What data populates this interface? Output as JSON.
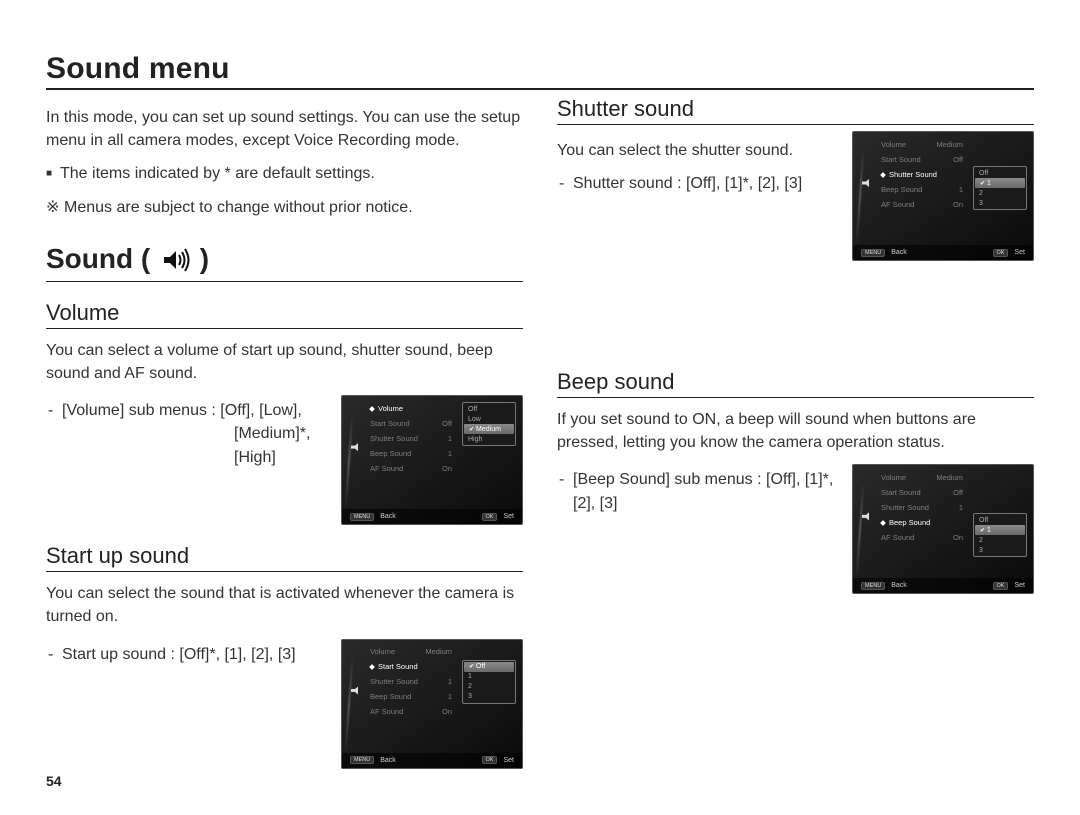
{
  "page_number": "54",
  "page_title": "Sound menu",
  "intro_text": "In this mode, you can set up sound settings. You can use the setup menu in all camera modes, except Voice Recording mode.",
  "default_note": "The items indicated by * are default settings.",
  "change_note": "Menus are subject to change without prior notice.",
  "sound_heading": "Sound ( ",
  "sound_heading_close": " )",
  "volume": {
    "title": "Volume",
    "desc": "You can select a volume of start up sound, shutter sound, beep sound and AF sound.",
    "line1": "[Volume] sub menus : [Off], [Low],",
    "line2": "[Medium]*, [High]"
  },
  "startup": {
    "title": "Start up sound",
    "desc": "You can select the sound that is activated whenever the camera is turned on.",
    "line": "Start up sound : [Off]*, [1], [2], [3]"
  },
  "shutter": {
    "title": "Shutter sound",
    "desc": "You can select the shutter sound.",
    "line": "Shutter sound : [Off], [1]*, [2], [3]"
  },
  "beep": {
    "title": "Beep sound",
    "desc": "If you set sound to ON, a beep will sound when buttons are pressed, letting you know the camera operation status.",
    "line": "[Beep Sound] sub menus : [Off], [1]*, [2], [3]"
  },
  "screen": {
    "menu": {
      "volume": "Volume",
      "start": "Start Sound",
      "shutter": "Shutter Sound",
      "beep": "Beep Sound",
      "af": "AF Sound"
    },
    "values": {
      "medium": "Medium",
      "off": "Off",
      "one": "1",
      "on": "On"
    },
    "volume_opts": [
      "Off",
      "Low",
      "Medium",
      "High"
    ],
    "num_opts": [
      "Off",
      "1",
      "2",
      "3"
    ],
    "bar": {
      "back_btn": "MENU",
      "back": "Back",
      "ok_btn": "OK",
      "set": "Set"
    }
  }
}
